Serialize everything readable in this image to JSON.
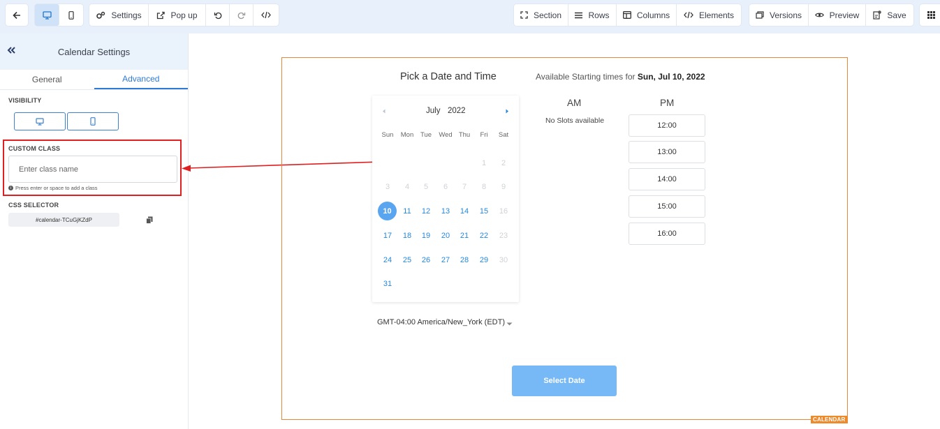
{
  "toolbar": {
    "back_icon": "arrow-left-icon",
    "desktop_icon": "desktop-icon",
    "mobile_icon": "mobile-icon",
    "settings_label": "Settings",
    "popup_label": "Pop up",
    "undo_icon": "undo-icon",
    "redo_icon": "redo-icon",
    "code_icon": "code-icon",
    "section_label": "Section",
    "rows_label": "Rows",
    "columns_label": "Columns",
    "elements_label": "Elements",
    "versions_label": "Versions",
    "preview_label": "Preview",
    "save_label": "Save",
    "apps_icon": "grid-icon"
  },
  "panel": {
    "title": "Calendar Settings",
    "tabs": [
      {
        "label": "General",
        "active": false
      },
      {
        "label": "Advanced",
        "active": true
      }
    ],
    "visibility_label": "VISIBILITY",
    "custom_class_label": "CUSTOM CLASS",
    "custom_class_placeholder": "Enter class name",
    "custom_class_value": "",
    "hint": "Press enter or space to add a class",
    "css_selector_label": "CSS SELECTOR",
    "css_selector_value": "#calendar-TCuGjKZdP"
  },
  "canvas": {
    "element_tag": "CALENDAR",
    "title": "Pick a Date and Time",
    "available_prefix": "Available Starting times for",
    "available_date": "Sun, Jul 10, 2022",
    "calendar": {
      "month": "July",
      "year": "2022",
      "weekdays": [
        "Sun",
        "Mon",
        "Tue",
        "Wed",
        "Thu",
        "Fri",
        "Sat"
      ],
      "selected_day": "10",
      "days": [
        [
          "",
          "",
          "",
          "",
          "",
          "1",
          "2"
        ],
        [
          "3",
          "4",
          "5",
          "6",
          "7",
          "8",
          "9"
        ],
        [
          "10",
          "11",
          "12",
          "13",
          "14",
          "15",
          "16"
        ],
        [
          "17",
          "18",
          "19",
          "20",
          "21",
          "22",
          "23"
        ],
        [
          "24",
          "25",
          "26",
          "27",
          "28",
          "29",
          "30"
        ],
        [
          "31",
          "",
          "",
          "",
          "",
          "",
          ""
        ]
      ],
      "enabled_days": [
        "10",
        "11",
        "12",
        "13",
        "14",
        "15",
        "17",
        "18",
        "19",
        "20",
        "21",
        "22",
        "24",
        "25",
        "26",
        "27",
        "28",
        "29",
        "31"
      ]
    },
    "timezone": "GMT-04:00 America/New_York (EDT)",
    "am_label": "AM",
    "pm_label": "PM",
    "no_slots": "No Slots available",
    "pm_slots": [
      "12:00",
      "13:00",
      "14:00",
      "15:00",
      "16:00"
    ],
    "select_button": "Select Date"
  },
  "colors": {
    "accent": "#2e7bd6",
    "highlight": "#e02020",
    "widget_border": "#e8863a",
    "selected_day": "#5aa5ef",
    "button": "#77b9f6"
  }
}
